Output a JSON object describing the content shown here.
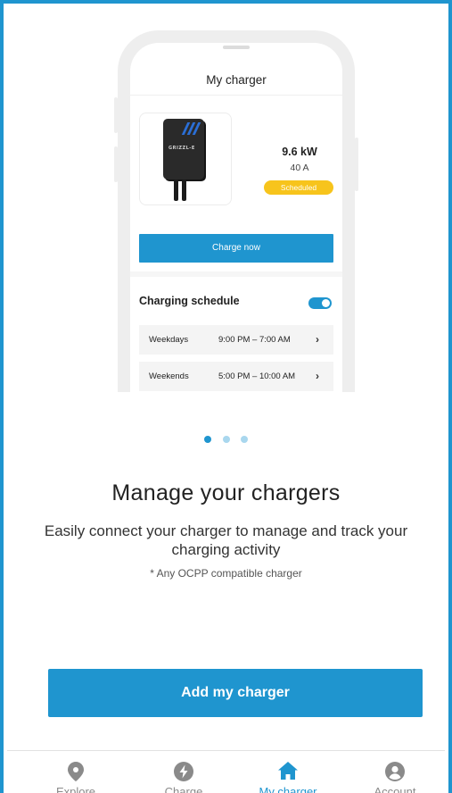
{
  "phone_screen": {
    "title": "My charger",
    "charger": {
      "logo_text": "GRIZZL-E",
      "power": "9.6 kW",
      "current": "40 A",
      "status_badge": "Scheduled"
    },
    "charge_now_label": "Charge now",
    "schedule": {
      "title": "Charging schedule",
      "enabled": true,
      "rows": [
        {
          "day": "Weekdays",
          "time": "9:00 PM – 7:00 AM"
        },
        {
          "day": "Weekends",
          "time": "5:00 PM – 10:00 AM"
        }
      ]
    }
  },
  "pager": {
    "count": 3,
    "active_index": 0
  },
  "onboarding": {
    "headline": "Manage your chargers",
    "description": "Easily connect your charger to manage and track your charging activity",
    "note": "* Any OCPP compatible charger"
  },
  "primary_button": {
    "label": "Add my charger"
  },
  "tabbar": {
    "active": "My charger",
    "tabs": [
      {
        "label": "Explore",
        "icon": "map-pin-icon"
      },
      {
        "label": "Charge",
        "icon": "lightning-icon"
      },
      {
        "label": "My charger",
        "icon": "home-icon"
      },
      {
        "label": "Account",
        "icon": "user-circle-icon"
      }
    ]
  },
  "colors": {
    "accent": "#1f95cf",
    "badge": "#f7c41c",
    "inactive_tab": "#8a8a8a"
  }
}
